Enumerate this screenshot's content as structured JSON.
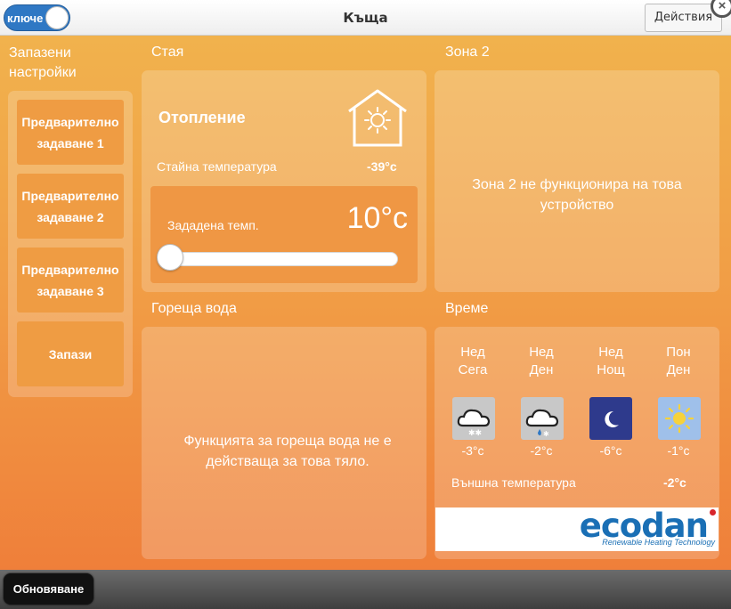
{
  "header": {
    "toggle_label": "ключе",
    "title": "Къща",
    "actions_label": "Действия",
    "close_label": "×"
  },
  "sidebar": {
    "title": "Запазени\nнастройки",
    "presets": [
      {
        "label": "Предварително\nзадаване 1"
      },
      {
        "label": "Предварително\nзадаване 2"
      },
      {
        "label": "Предварително\nзадаване 3"
      }
    ],
    "save_label": "Запази"
  },
  "room": {
    "title": "Стая",
    "heating_label": "Отопление",
    "room_temp_label": "Стайна температура",
    "room_temp_value": "-39°c",
    "setpoint_label": "Зададена темп.",
    "setpoint_value": "10°c",
    "setpoint_slider_fraction": 0
  },
  "zone2": {
    "title": "Зона 2",
    "message": "Зона 2 не функционира на това устройство"
  },
  "hot_water": {
    "title": "Гореща вода",
    "message": "Функцията за гореща вода не е действаща за това тяло."
  },
  "weather": {
    "title": "Време",
    "columns": [
      {
        "day": "Нед",
        "period": "Сега",
        "icon": "cloud-snow-icon",
        "temp": "-3°c"
      },
      {
        "day": "Нед",
        "period": "Ден",
        "icon": "cloud-sleet-icon",
        "temp": "-2°c"
      },
      {
        "day": "Нед",
        "period": "Нощ",
        "icon": "moon-icon",
        "temp": "-6°c"
      },
      {
        "day": "Пон",
        "period": "Ден",
        "icon": "sun-icon",
        "temp": "-1°c"
      }
    ],
    "outside_label": "Външна температура",
    "outside_value": "-2°c"
  },
  "brand": {
    "name": "ecodan",
    "tagline": "Renewable Heating Technology"
  },
  "footer": {
    "refresh_label": "Обновяване"
  },
  "colors": {
    "accent_blue": "#2f78c4",
    "brand_blue": "#1a6fb5",
    "night_icon_bg": "#2e3a8c",
    "sun_icon_bg": "#9fc0ea",
    "cloud_icon_bg": "#c8c8c8"
  }
}
